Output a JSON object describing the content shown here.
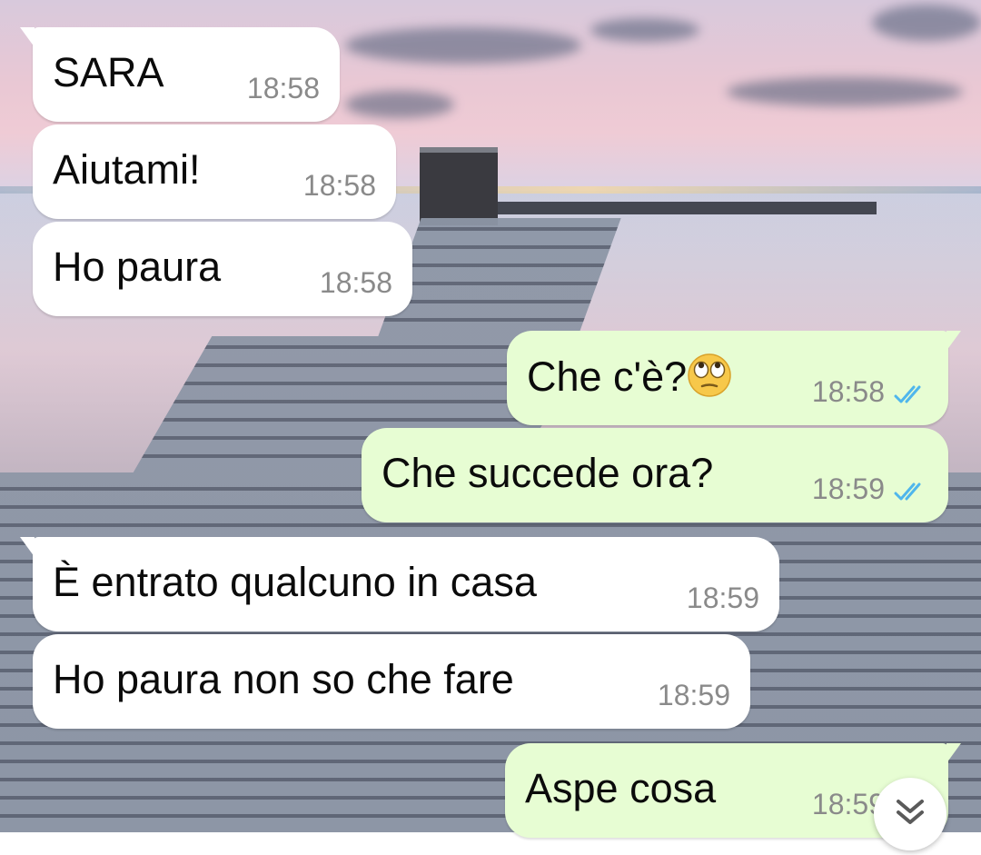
{
  "messages": [
    {
      "direction": "in",
      "text": "SARA",
      "time": "18:58"
    },
    {
      "direction": "in",
      "text": "Aiutami!",
      "time": "18:58"
    },
    {
      "direction": "in",
      "text": "Ho paura",
      "time": "18:58"
    },
    {
      "direction": "out",
      "text": "Che c'è?",
      "emoji": "face-with-rolling-eyes-icon",
      "time": "18:58",
      "status": "read"
    },
    {
      "direction": "out",
      "text": "Che succede ora?",
      "time": "18:59",
      "status": "read"
    },
    {
      "direction": "in",
      "text": "È entrato qualcuno in casa",
      "time": "18:59"
    },
    {
      "direction": "in",
      "text": "Ho paura non so che fare",
      "time": "18:59"
    },
    {
      "direction": "out",
      "text": "Aspe cosa",
      "time": "18:59",
      "status": "read"
    }
  ],
  "colors": {
    "incoming_bubble": "#ffffff",
    "outgoing_bubble": "#e7fdd3",
    "read_ticks": "#4fb6ec",
    "timestamp": "#8a8a8a"
  },
  "scroll_button_icon": "double-chevron-down-icon"
}
